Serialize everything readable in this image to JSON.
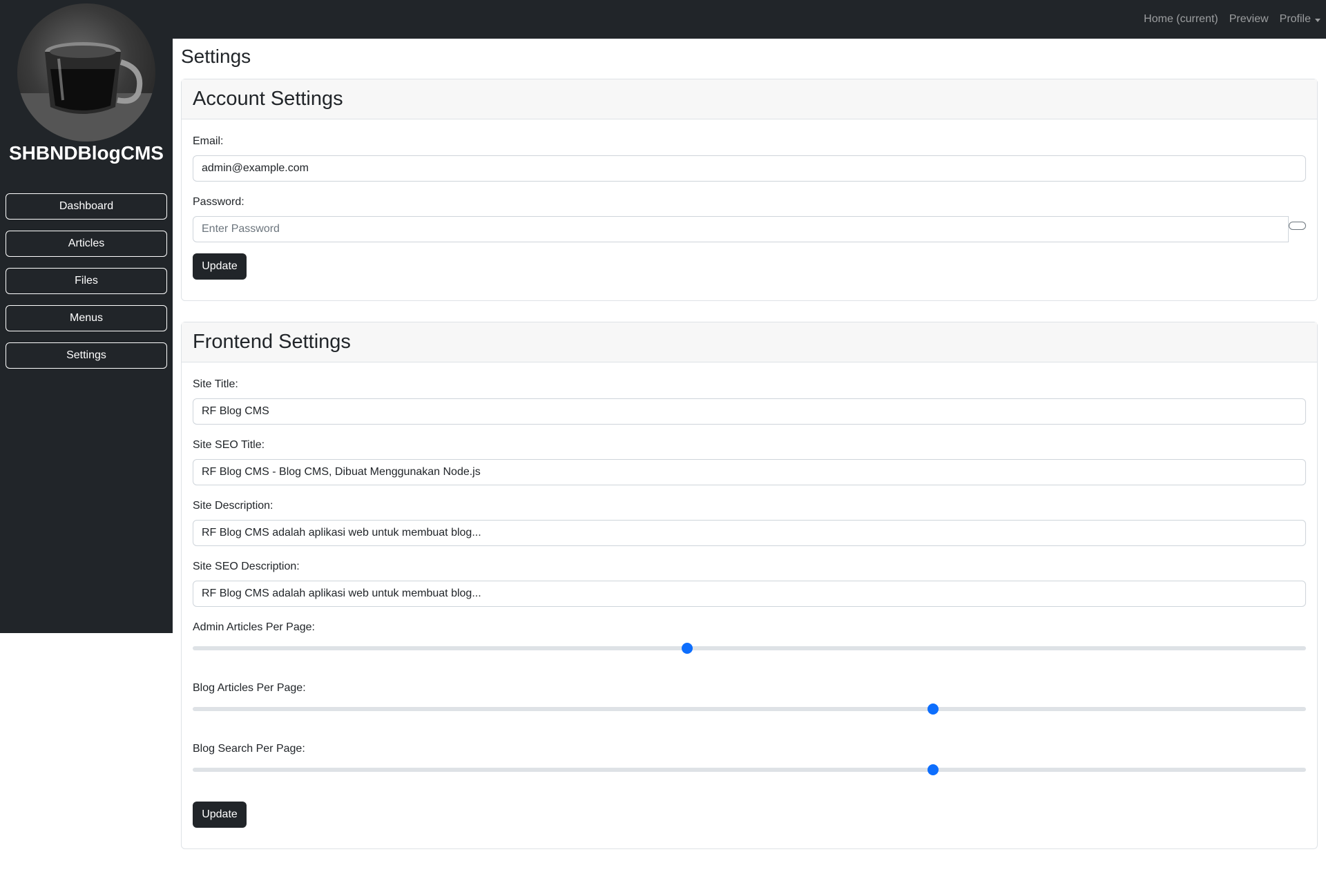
{
  "brand": {
    "name": "SHBNDBlogCMS"
  },
  "topnav": {
    "home": "Home (current)",
    "preview": "Preview",
    "profile": "Profile"
  },
  "sidebar": {
    "items": [
      {
        "label": "Dashboard"
      },
      {
        "label": "Articles"
      },
      {
        "label": "Files"
      },
      {
        "label": "Menus"
      },
      {
        "label": "Settings"
      }
    ]
  },
  "page": {
    "title": "Settings"
  },
  "account": {
    "header": "Account Settings",
    "email_label": "Email:",
    "email_value": "admin@example.com",
    "password_label": "Password:",
    "password_placeholder": "Enter Password",
    "update_label": "Update"
  },
  "frontend": {
    "header": "Frontend Settings",
    "site_title_label": "Site Title:",
    "site_title_value": "RF Blog CMS",
    "seo_title_label": "Site SEO Title:",
    "seo_title_value": "RF Blog CMS - Blog CMS, Dibuat Menggunakan Node.js",
    "description_label": "Site Description:",
    "description_value": "RF Blog CMS adalah aplikasi web untuk membuat blog...",
    "seo_description_label": "Site SEO Description:",
    "seo_description_value": "RF Blog CMS adalah aplikasi web untuk membuat blog...",
    "admin_per_page_label": "Admin Articles Per Page:",
    "admin_per_page_level": 0.444,
    "blog_per_page_label": "Blog Articles Per Page:",
    "blog_per_page_level": 0.665,
    "search_per_page_label": "Blog Search Per Page:",
    "search_per_page_level": 0.665,
    "update_label": "Update"
  },
  "colors": {
    "dark": "#212529",
    "accent": "#0d6efd"
  }
}
